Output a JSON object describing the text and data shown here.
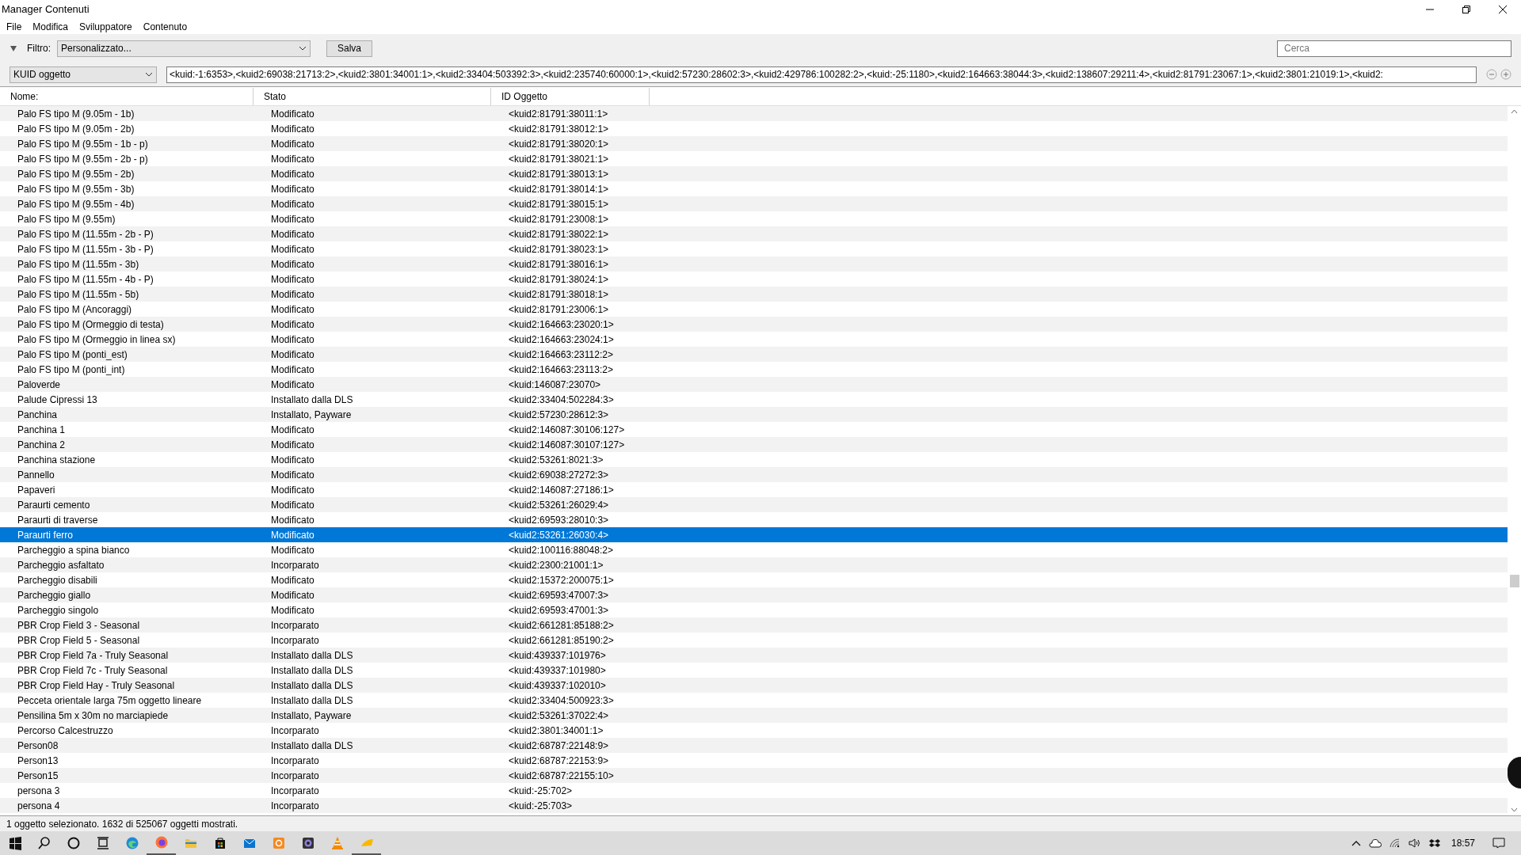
{
  "window": {
    "title": "Manager Contenuti"
  },
  "menu": [
    "File",
    "Modifica",
    "Sviluppatore",
    "Contenuto"
  ],
  "filter": {
    "label": "Filtro:",
    "value": "Personalizzato...",
    "save_button": "Salva",
    "expanded": true
  },
  "search": {
    "placeholder": "Cerca"
  },
  "kuid_filter": {
    "field": "KUID oggetto",
    "value": "<kuid:-1:6353>,<kuid2:69038:21713:2>,<kuid2:3801:34001:1>,<kuid2:33404:503392:3>,<kuid2:235740:60000:1>,<kuid2:57230:28602:3>,<kuid2:429786:100282:2>,<kuid:-25:1180>,<kuid2:164663:38044:3>,<kuid2:138607:29211:4>,<kuid2:81791:23067:1>,<kuid2:3801:21019:1>,<kuid2:"
  },
  "table": {
    "columns": [
      "Nome:",
      "Stato",
      "ID Oggetto"
    ],
    "rows": [
      {
        "name": "Palo FS tipo M (9.05m - 1b)",
        "status": "Modificato",
        "id": "<kuid2:81791:38011:1>",
        "selected": false
      },
      {
        "name": "Palo FS tipo M (9.05m - 2b)",
        "status": "Modificato",
        "id": "<kuid2:81791:38012:1>",
        "selected": false
      },
      {
        "name": "Palo FS tipo M (9.55m - 1b - p)",
        "status": "Modificato",
        "id": "<kuid2:81791:38020:1>",
        "selected": false
      },
      {
        "name": "Palo FS tipo M (9.55m - 2b - p)",
        "status": "Modificato",
        "id": "<kuid2:81791:38021:1>",
        "selected": false
      },
      {
        "name": "Palo FS tipo M (9.55m - 2b)",
        "status": "Modificato",
        "id": "<kuid2:81791:38013:1>",
        "selected": false
      },
      {
        "name": "Palo FS tipo M (9.55m - 3b)",
        "status": "Modificato",
        "id": "<kuid2:81791:38014:1>",
        "selected": false
      },
      {
        "name": "Palo FS tipo M (9.55m - 4b)",
        "status": "Modificato",
        "id": "<kuid2:81791:38015:1>",
        "selected": false
      },
      {
        "name": "Palo FS tipo M (9.55m)",
        "status": "Modificato",
        "id": "<kuid2:81791:23008:1>",
        "selected": false
      },
      {
        "name": "Palo FS tipo M (11.55m - 2b - P)",
        "status": "Modificato",
        "id": "<kuid2:81791:38022:1>",
        "selected": false
      },
      {
        "name": "Palo FS tipo M (11.55m - 3b - P)",
        "status": "Modificato",
        "id": "<kuid2:81791:38023:1>",
        "selected": false
      },
      {
        "name": "Palo FS tipo M (11.55m - 3b)",
        "status": "Modificato",
        "id": "<kuid2:81791:38016:1>",
        "selected": false
      },
      {
        "name": "Palo FS tipo M (11.55m - 4b - P)",
        "status": "Modificato",
        "id": "<kuid2:81791:38024:1>",
        "selected": false
      },
      {
        "name": "Palo FS tipo M (11.55m - 5b)",
        "status": "Modificato",
        "id": "<kuid2:81791:38018:1>",
        "selected": false
      },
      {
        "name": "Palo FS tipo M (Ancoraggi)",
        "status": "Modificato",
        "id": "<kuid2:81791:23006:1>",
        "selected": false
      },
      {
        "name": "Palo FS tipo M (Ormeggio di testa)",
        "status": "Modificato",
        "id": "<kuid2:164663:23020:1>",
        "selected": false
      },
      {
        "name": "Palo FS tipo M (Ormeggio in linea sx)",
        "status": "Modificato",
        "id": "<kuid2:164663:23024:1>",
        "selected": false
      },
      {
        "name": "Palo FS tipo M (ponti_est)",
        "status": "Modificato",
        "id": "<kuid2:164663:23112:2>",
        "selected": false
      },
      {
        "name": "Palo FS tipo M (ponti_int)",
        "status": "Modificato",
        "id": "<kuid2:164663:23113:2>",
        "selected": false
      },
      {
        "name": "Paloverde",
        "status": "Modificato",
        "id": "<kuid:146087:23070>",
        "selected": false
      },
      {
        "name": "Palude Cipressi 13",
        "status": "Installato dalla DLS",
        "id": "<kuid2:33404:502284:3>",
        "selected": false
      },
      {
        "name": "Panchina",
        "status": "Installato, Payware",
        "id": "<kuid2:57230:28612:3>",
        "selected": false
      },
      {
        "name": "Panchina 1",
        "status": "Modificato",
        "id": "<kuid2:146087:30106:127>",
        "selected": false
      },
      {
        "name": "Panchina 2",
        "status": "Modificato",
        "id": "<kuid2:146087:30107:127>",
        "selected": false
      },
      {
        "name": "Panchina stazione",
        "status": "Modificato",
        "id": "<kuid2:53261:8021:3>",
        "selected": false
      },
      {
        "name": "Pannello",
        "status": "Modificato",
        "id": "<kuid2:69038:27272:3>",
        "selected": false
      },
      {
        "name": "Papaveri",
        "status": "Modificato",
        "id": "<kuid2:146087:27186:1>",
        "selected": false
      },
      {
        "name": "Paraurti cemento",
        "status": "Modificato",
        "id": "<kuid2:53261:26029:4>",
        "selected": false
      },
      {
        "name": "Paraurti di traverse",
        "status": "Modificato",
        "id": "<kuid2:69593:28010:3>",
        "selected": false
      },
      {
        "name": "Paraurti ferro",
        "status": "Modificato",
        "id": "<kuid2:53261:26030:4>",
        "selected": true
      },
      {
        "name": "Parcheggio a spina bianco",
        "status": "Modificato",
        "id": "<kuid2:100116:88048:2>",
        "selected": false
      },
      {
        "name": "Parcheggio asfaltato",
        "status": "Incorparato",
        "id": "<kuid2:2300:21001:1>",
        "selected": false
      },
      {
        "name": "Parcheggio disabili",
        "status": "Modificato",
        "id": "<kuid2:15372:200075:1>",
        "selected": false
      },
      {
        "name": "Parcheggio giallo",
        "status": "Modificato",
        "id": "<kuid2:69593:47007:3>",
        "selected": false
      },
      {
        "name": "Parcheggio singolo",
        "status": "Modificato",
        "id": "<kuid2:69593:47001:3>",
        "selected": false
      },
      {
        "name": "PBR Crop Field 3 - Seasonal",
        "status": "Incorparato",
        "id": "<kuid2:661281:85188:2>",
        "selected": false
      },
      {
        "name": "PBR Crop Field 5 - Seasonal",
        "status": "Incorparato",
        "id": "<kuid2:661281:85190:2>",
        "selected": false
      },
      {
        "name": "PBR Crop Field 7a - Truly Seasonal",
        "status": "Installato dalla DLS",
        "id": "<kuid:439337:101976>",
        "selected": false
      },
      {
        "name": "PBR Crop Field 7c - Truly Seasonal",
        "status": "Installato dalla DLS",
        "id": "<kuid:439337:101980>",
        "selected": false
      },
      {
        "name": "PBR Crop Field Hay - Truly Seasonal",
        "status": "Installato dalla DLS",
        "id": "<kuid:439337:102010>",
        "selected": false
      },
      {
        "name": "Pecceta orientale larga 75m oggetto lineare",
        "status": "Installato dalla DLS",
        "id": "<kuid2:33404:500923:3>",
        "selected": false
      },
      {
        "name": "Pensilina 5m x 30m no marciapiede",
        "status": "Installato, Payware",
        "id": "<kuid2:53261:37022:4>",
        "selected": false
      },
      {
        "name": "Percorso Calcestruzzo",
        "status": "Incorparato",
        "id": "<kuid2:3801:34001:1>",
        "selected": false
      },
      {
        "name": "Person08",
        "status": "Installato dalla DLS",
        "id": "<kuid2:68787:22148:9>",
        "selected": false
      },
      {
        "name": "Person13",
        "status": "Incorparato",
        "id": "<kuid2:68787:22153:9>",
        "selected": false
      },
      {
        "name": "Person15",
        "status": "Incorparato",
        "id": "<kuid2:68787:22155:10>",
        "selected": false
      },
      {
        "name": "persona 3",
        "status": "Incorparato",
        "id": "<kuid:-25:702>",
        "selected": false
      },
      {
        "name": "persona 4",
        "status": "Incorparato",
        "id": "<kuid:-25:703>",
        "selected": false
      }
    ]
  },
  "status_bar": "1 oggetto selezionato. 1632 di 525067 oggetti mostrati.",
  "taskbar": {
    "apps": [
      {
        "kind": "edge",
        "running": false
      },
      {
        "kind": "firefox",
        "running": true
      },
      {
        "kind": "folder",
        "running": false
      },
      {
        "kind": "store",
        "running": false
      },
      {
        "kind": "mail",
        "running": false
      },
      {
        "kind": "orange",
        "running": false
      },
      {
        "kind": "camera",
        "running": false
      },
      {
        "kind": "cone",
        "running": false
      },
      {
        "kind": "wedge",
        "running": true
      }
    ],
    "clock": "18:57"
  }
}
